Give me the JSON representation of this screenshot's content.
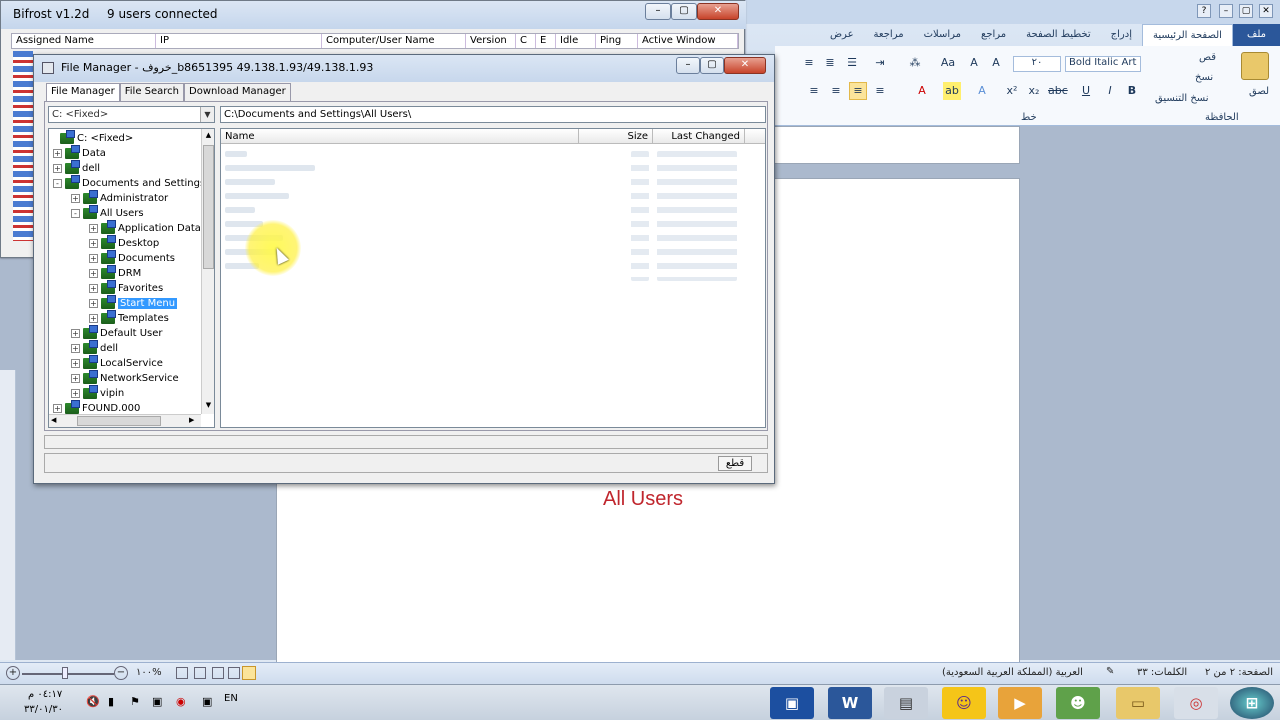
{
  "word": {
    "tabs": [
      "ملف",
      "الصفحة الرئيسية",
      "إدراج",
      "تخطيط الصفحة",
      "مراجع",
      "مراسلات",
      "مراجعة",
      "عرض"
    ],
    "active_tab": "الصفحة الرئيسية",
    "font_name": "Bold Italic Art",
    "font_size": "٢٠",
    "clipboard": {
      "paste": "لصق",
      "cut": "قص",
      "copy": "نسخ",
      "format_painter": "نسخ التنسيق",
      "group": "الحافظة"
    },
    "font_group": "خط",
    "doc_text": "All Users"
  },
  "statusbar": {
    "page": "الصفحة: ٢ من ٢",
    "words": "الكلمات: ٣٣",
    "language": "العربية (المملكة العربية السعودية)",
    "zoom": "١٠٠%"
  },
  "taskbar": {
    "lang": "EN",
    "time": "٠٤:١٧ م",
    "date": "٣٣/٠١/٣٠"
  },
  "bifrost": {
    "title": "Bifrost v1.2d",
    "connected": "9 users connected",
    "columns": [
      "Assigned Name",
      "IP",
      "Computer/User Name",
      "Version",
      "C",
      "E",
      "Idle",
      "Ping",
      "Active Window"
    ]
  },
  "file_manager": {
    "title": "File Manager - خروف_b8651395 49.138.1.93/49.138.1.93",
    "tabs": [
      "File Manager",
      "File Search",
      "Download Manager"
    ],
    "active_tab": "File Manager",
    "drive": "C: <Fixed>",
    "path": "C:\\Documents and Settings\\All Users\\",
    "list_columns": [
      "Name",
      "Size",
      "Last Changed"
    ],
    "cut_button": "قطع",
    "tree": [
      {
        "label": "C: <Fixed>",
        "level": 0,
        "exp": ""
      },
      {
        "label": "Data",
        "level": 0,
        "exp": "+"
      },
      {
        "label": "dell",
        "level": 0,
        "exp": "+"
      },
      {
        "label": "Documents and Settings",
        "level": 0,
        "exp": "-"
      },
      {
        "label": "Administrator",
        "level": 1,
        "exp": "+"
      },
      {
        "label": "All Users",
        "level": 1,
        "exp": "-"
      },
      {
        "label": "Application Data",
        "level": 2,
        "exp": "+"
      },
      {
        "label": "Desktop",
        "level": 2,
        "exp": "+"
      },
      {
        "label": "Documents",
        "level": 2,
        "exp": "+"
      },
      {
        "label": "DRM",
        "level": 2,
        "exp": "+"
      },
      {
        "label": "Favorites",
        "level": 2,
        "exp": "+"
      },
      {
        "label": "Start Menu",
        "level": 2,
        "exp": "+",
        "selected": true
      },
      {
        "label": "Templates",
        "level": 2,
        "exp": "+"
      },
      {
        "label": "Default User",
        "level": 1,
        "exp": "+"
      },
      {
        "label": "dell",
        "level": 1,
        "exp": "+"
      },
      {
        "label": "LocalService",
        "level": 1,
        "exp": "+"
      },
      {
        "label": "NetworkService",
        "level": 1,
        "exp": "+"
      },
      {
        "label": "vipin",
        "level": 1,
        "exp": "+"
      },
      {
        "label": "FOUND.000",
        "level": 0,
        "exp": "+"
      }
    ]
  },
  "colors": {
    "accent": "#2b579a",
    "selection": "#3399ff",
    "doc_text": "#c0262d",
    "highlight": "#fff23c"
  }
}
